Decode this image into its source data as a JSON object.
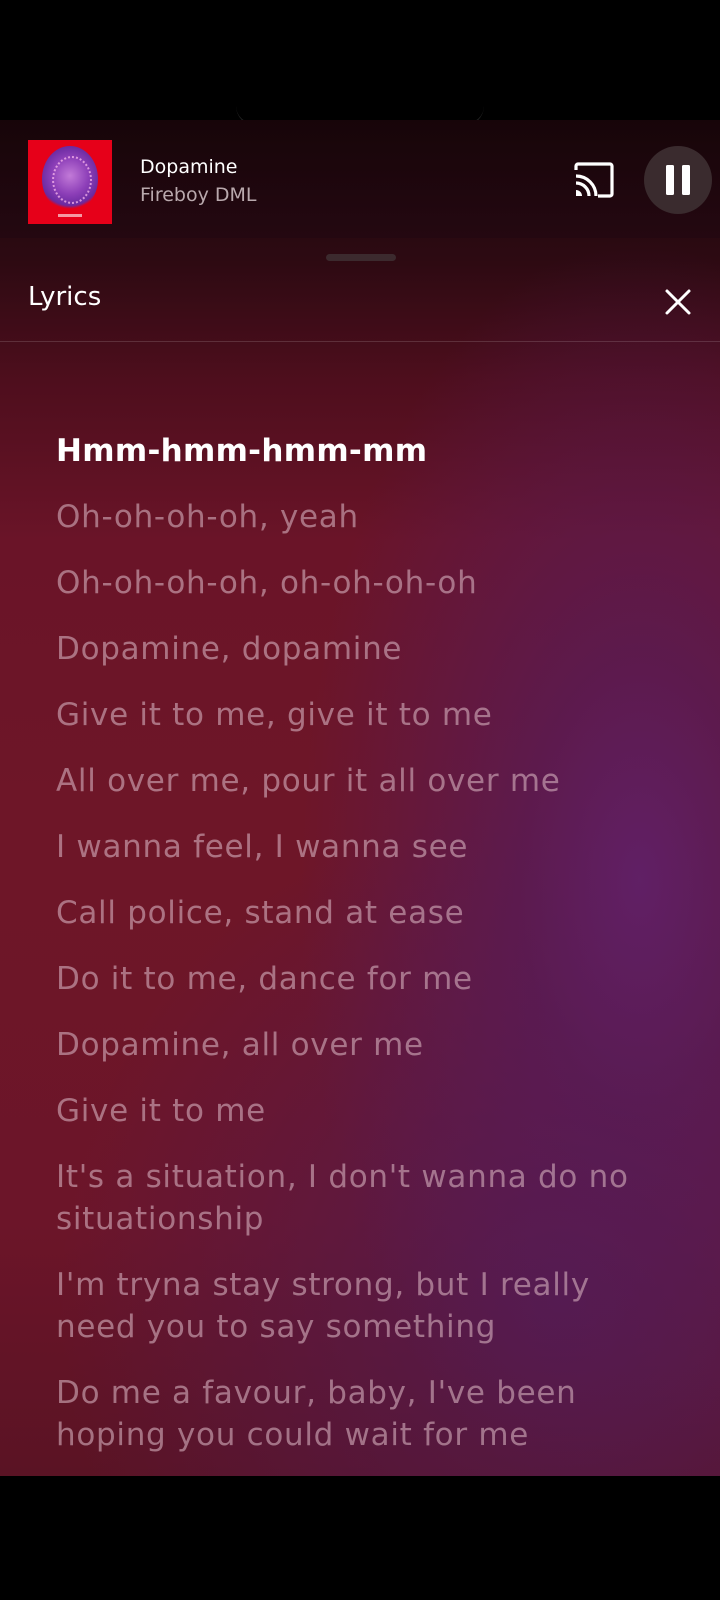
{
  "mini_player": {
    "title": "Dopamine",
    "artist": "Fireboy DML",
    "album_art_icon": "album-cover",
    "cast_icon": "cast-icon",
    "pause_icon": "pause-icon"
  },
  "lyrics_panel": {
    "title": "Lyrics",
    "close_icon": "close-icon",
    "lines": [
      "Hmm-hmm-hmm-mm",
      "Oh-oh-oh-oh, yeah",
      "Oh-oh-oh-oh, oh-oh-oh-oh",
      "Dopamine, dopamine",
      "Give it to me, give it to me",
      "All over me, pour it all over me",
      "I wanna feel, I wanna see",
      "Call police, stand at ease",
      "Do it to me, dance for me",
      "Dopamine, all over me",
      "Give it to me",
      "It's a situation, I don't wanna do no situationship",
      "I'm tryna stay strong, but I really need you to say something",
      "Do me a favour, baby, I've been hoping you could wait for me"
    ],
    "active_line_index": 0
  },
  "colors": {
    "active_lyric": "#ffffff",
    "inactive_lyric": "#d6b0be",
    "album_art_bg": "#e60019"
  }
}
